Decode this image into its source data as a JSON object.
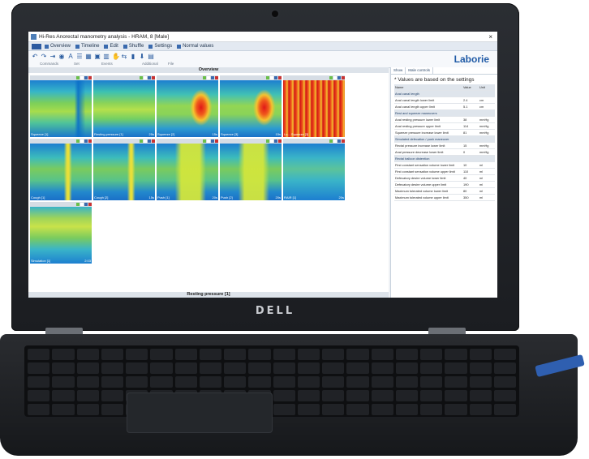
{
  "hardware": {
    "brand": "DELL"
  },
  "window": {
    "title": "Hi-Res Anorectal manometry analysis - HRAM, 8 [Male]",
    "close_glyph": "×"
  },
  "menu": {
    "items": [
      "Overview",
      "Timeline",
      "Edit",
      "Shuffle",
      "Settings",
      "Normal values"
    ]
  },
  "toolbar": {
    "icons": [
      "undo-icon",
      "redo-icon",
      "split-icon",
      "eye-icon",
      "text-icon",
      "list-icon",
      "layout-icon",
      "book-icon",
      "trash-icon",
      "hand-icon",
      "arrows-icon",
      "marker-icon",
      "pin-icon",
      "doc-icon"
    ],
    "groups": [
      "Commands",
      "Set",
      "Events",
      "Additional",
      "File"
    ],
    "logo": "Laborie"
  },
  "overview": {
    "title": "Overview",
    "status": "Resting pressure [1]",
    "panels": [
      {
        "label": "Squeeze [1]",
        "right": "",
        "pattern": "drop"
      },
      {
        "label": "Resting pressure [1]",
        "right": "25s",
        "pattern": "rest"
      },
      {
        "label": "Squeeze [2]",
        "right": "15s",
        "pattern": "squeeze"
      },
      {
        "label": "Squeeze [3]",
        "right": "15s",
        "pattern": "squeeze"
      },
      {
        "label": "Lo... Squeeze [3]",
        "right": "",
        "pattern": "bands"
      },
      {
        "label": "Cough [1]",
        "right": "",
        "pattern": "cough"
      },
      {
        "label": "Cough [2]",
        "right": "15s",
        "pattern": "cough"
      },
      {
        "label": "Push [1]",
        "right": "20s",
        "pattern": "push"
      },
      {
        "label": "Push [2]",
        "right": "20s",
        "pattern": "push"
      },
      {
        "label": "RAIR [1]",
        "right": "20s",
        "pattern": "rair"
      },
      {
        "label": "Simulation [1]",
        "right": "2:03",
        "pattern": "sim"
      }
    ]
  },
  "side": {
    "tabs": [
      "Show",
      "Male controls"
    ],
    "note": "* Values are based on the settings",
    "headers": [
      "Name",
      "Value",
      "Unit"
    ],
    "rows": [
      {
        "section": "Anal canal length"
      },
      {
        "name": "Anal canal length lower limit",
        "value": "2.4",
        "unit": "cm"
      },
      {
        "name": "Anal canal length upper limit",
        "value": "5.1",
        "unit": "cm"
      },
      {
        "section": "Rest and squeeze maneuvers"
      },
      {
        "name": "Anal resting pressure lower limit",
        "value": "38",
        "unit": "mmHg"
      },
      {
        "name": "Anal resting pressure upper limit",
        "value": "114",
        "unit": "mmHg"
      },
      {
        "name": "Squeeze pressure increase lower limit",
        "value": "81",
        "unit": "mmHg"
      },
      {
        "section": "Simulated defecation / push maneuver"
      },
      {
        "name": "Rectal pressure increase lower limit",
        "value": "15",
        "unit": "mmHg"
      },
      {
        "name": "Anal pressure decrease lower limit",
        "value": "0",
        "unit": "mmHg"
      },
      {
        "section": "Rectal balloon distention"
      },
      {
        "name": "First constant sensation volume lower limit",
        "value": "10",
        "unit": "ml"
      },
      {
        "name": "First constant sensation volume upper limit",
        "value": "110",
        "unit": "ml"
      },
      {
        "name": "Defecatory desire volume lower limit",
        "value": "40",
        "unit": "ml"
      },
      {
        "name": "Defecatory desire volume upper limit",
        "value": "190",
        "unit": "ml"
      },
      {
        "name": "Maximum tolerated volume lower limit",
        "value": "80",
        "unit": "ml"
      },
      {
        "name": "Maximum tolerated volume upper limit",
        "value": "350",
        "unit": "ml"
      }
    ]
  }
}
